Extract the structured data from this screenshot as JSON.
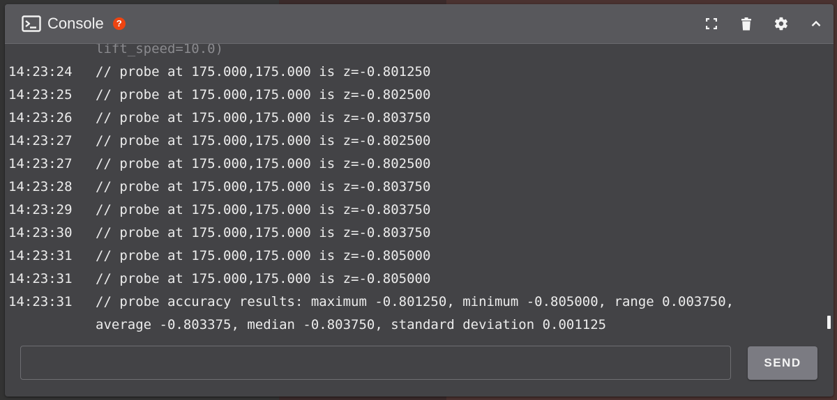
{
  "panel": {
    "title": "Console",
    "help_badge": "?",
    "actions": [
      {
        "name": "fullscreen-icon"
      },
      {
        "name": "trash-icon"
      },
      {
        "name": "gear-icon"
      },
      {
        "name": "chevron-up-icon"
      }
    ]
  },
  "log": {
    "partial_top": "lift_speed=10.0)",
    "entries": [
      {
        "time": "14:23:24",
        "message": "// probe at 175.000,175.000 is z=-0.801250"
      },
      {
        "time": "14:23:25",
        "message": "// probe at 175.000,175.000 is z=-0.802500"
      },
      {
        "time": "14:23:26",
        "message": "// probe at 175.000,175.000 is z=-0.803750"
      },
      {
        "time": "14:23:27",
        "message": "// probe at 175.000,175.000 is z=-0.802500"
      },
      {
        "time": "14:23:27",
        "message": "// probe at 175.000,175.000 is z=-0.802500"
      },
      {
        "time": "14:23:28",
        "message": "// probe at 175.000,175.000 is z=-0.803750"
      },
      {
        "time": "14:23:29",
        "message": "// probe at 175.000,175.000 is z=-0.803750"
      },
      {
        "time": "14:23:30",
        "message": "// probe at 175.000,175.000 is z=-0.803750"
      },
      {
        "time": "14:23:31",
        "message": "// probe at 175.000,175.000 is z=-0.805000"
      },
      {
        "time": "14:23:31",
        "message": "// probe at 175.000,175.000 is z=-0.805000"
      },
      {
        "time": "14:23:31",
        "message": "// probe accuracy results: maximum -0.801250, minimum -0.805000, range 0.003750,",
        "continuation": "average -0.803375, median -0.803750, standard deviation 0.001125"
      }
    ]
  },
  "command": {
    "value": "",
    "placeholder": "",
    "send_label": "SEND"
  },
  "colors": {
    "panel_bg": "#434346",
    "header_bg": "#58585c",
    "help_badge": "#ee4411",
    "send_button": "#7b7b82"
  }
}
